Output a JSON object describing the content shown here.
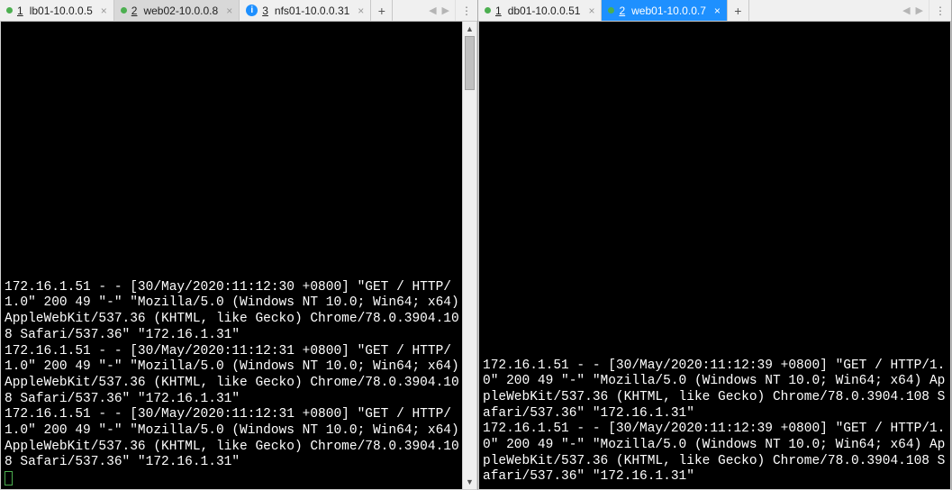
{
  "panes": {
    "left": {
      "tabs": [
        {
          "num": "1",
          "label": "lb01-10.0.0.5",
          "icon": "dot"
        },
        {
          "num": "2",
          "label": "web02-10.0.0.8",
          "icon": "dot"
        },
        {
          "num": "3",
          "label": "nfs01-10.0.0.31",
          "icon": "info"
        }
      ],
      "active_index": 1,
      "terminal": "\n\n\n\n\n\n\n\n\n\n\n\n\n\n172.16.1.51 - - [30/May/2020:11:12:30 +0800] \"GET / HTTP/1.0\" 200 49 \"-\" \"Mozilla/5.0 (Windows NT 10.0; Win64; x64) AppleWebKit/537.36 (KHTML, like Gecko) Chrome/78.0.3904.108 Safari/537.36\" \"172.16.1.31\"\n172.16.1.51 - - [30/May/2020:11:12:31 +0800] \"GET / HTTP/1.0\" 200 49 \"-\" \"Mozilla/5.0 (Windows NT 10.0; Win64; x64) AppleWebKit/537.36 (KHTML, like Gecko) Chrome/78.0.3904.108 Safari/537.36\" \"172.16.1.31\"\n172.16.1.51 - - [30/May/2020:11:12:31 +0800] \"GET / HTTP/1.0\" 200 49 \"-\" \"Mozilla/5.0 (Windows NT 10.0; Win64; x64) AppleWebKit/537.36 (KHTML, like Gecko) Chrome/78.0.3904.108 Safari/537.36\" \"172.16.1.31\""
    },
    "right": {
      "tabs": [
        {
          "num": "1",
          "label": "db01-10.0.0.51",
          "icon": "dot"
        },
        {
          "num": "2",
          "label": "web01-10.0.0.7",
          "icon": "dot"
        }
      ],
      "active_index": 1,
      "terminal": "\n\n\n\n\n\n\n\n\n\n\n\n\n\n\n\n\n\n172.16.1.51 - - [30/May/2020:11:12:39 +0800] \"GET / HTTP/1.0\" 200 49 \"-\" \"Mozilla/5.0 (Windows NT 10.0; Win64; x64) AppleWebKit/537.36 (KHTML, like Gecko) Chrome/78.0.3904.108 Safari/537.36\" \"172.16.1.31\"\n172.16.1.51 - - [30/May/2020:11:12:39 +0800] \"GET / HTTP/1.0\" 200 49 \"-\" \"Mozilla/5.0 (Windows NT 10.0; Win64; x64) AppleWebKit/537.36 (KHTML, like Gecko) Chrome/78.0.3904.108 Safari/537.36\" \"172.16.1.31\""
    }
  },
  "glyphs": {
    "close": "×",
    "plus": "+",
    "left": "◀",
    "right": "▶",
    "up": "▲",
    "down": "▼",
    "menu": "⋮",
    "info": "i"
  }
}
